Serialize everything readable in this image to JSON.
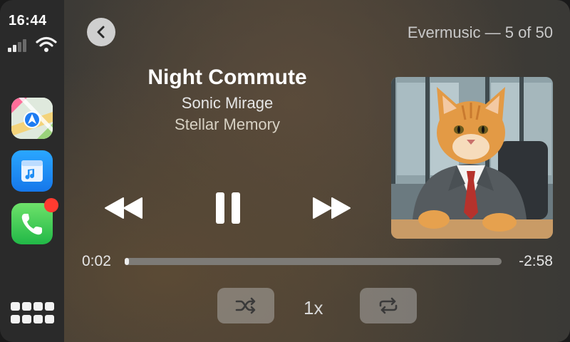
{
  "status": {
    "time": "16:44"
  },
  "header": {
    "source": "Evermusic — 5 of 50"
  },
  "track": {
    "title": "Night Commute",
    "artist": "Sonic Mirage",
    "album": "Stellar Memory"
  },
  "progress": {
    "elapsed": "0:02",
    "remaining": "-2:58",
    "fraction": 0.011
  },
  "controls": {
    "speed": "1x",
    "icons": [
      "back-icon",
      "rewind-icon",
      "pause-icon",
      "fast-forward-icon",
      "shuffle-icon",
      "repeat-icon"
    ]
  },
  "apps": [
    "maps",
    "music",
    "phone",
    "app-grid"
  ],
  "colors": {
    "maps_accent": "#1e7cf2",
    "music_accent": "#1f8ef5",
    "phone_accent": "#34c759",
    "badge": "#ff3b30"
  }
}
